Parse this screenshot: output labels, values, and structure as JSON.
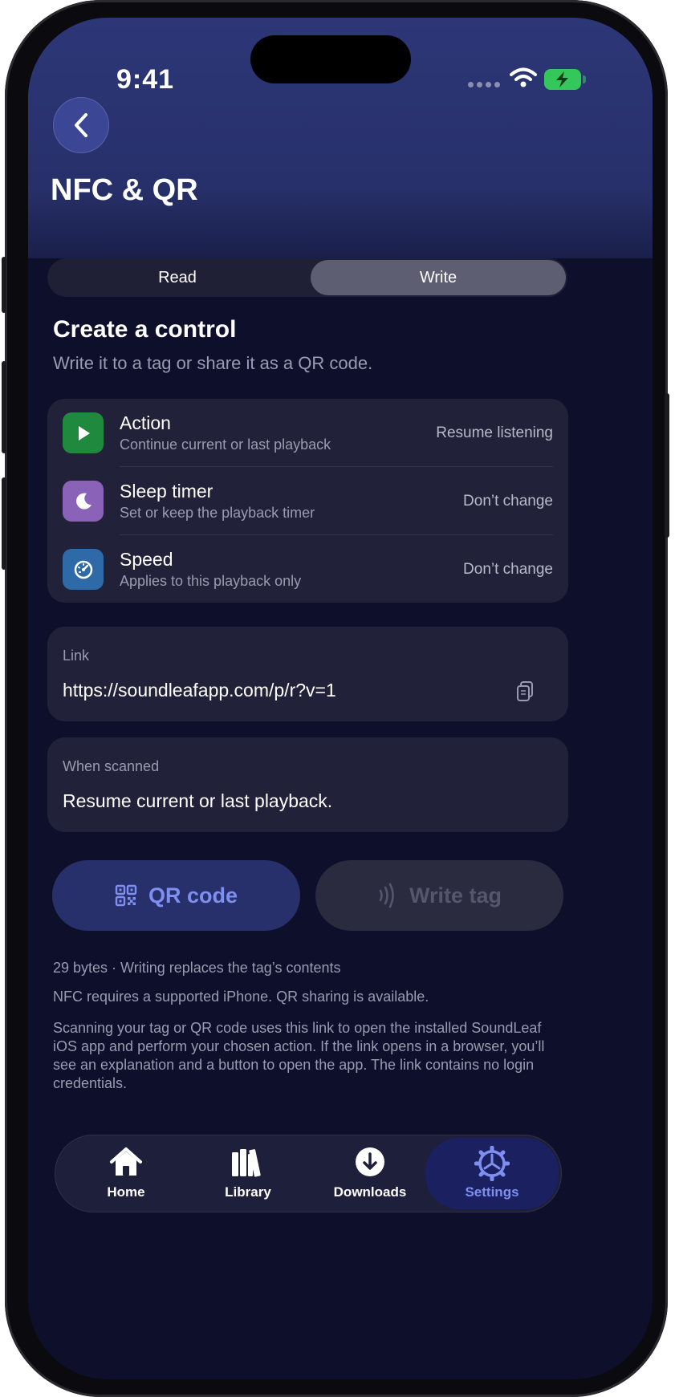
{
  "status_bar": {
    "time": "9:41"
  },
  "header": {
    "title": "NFC & QR"
  },
  "segmented": {
    "options": [
      "Read",
      "Write"
    ],
    "selected": "Write"
  },
  "section": {
    "title": "Create a control",
    "subtitle": "Write it to a tag or share it as a QR code."
  },
  "settings": [
    {
      "title": "Action",
      "subtitle": "Continue current or last playback",
      "value": "Resume listening",
      "icon": "play-icon",
      "color": "#1f8a3e"
    },
    {
      "title": "Sleep timer",
      "subtitle": "Set or keep the playback timer",
      "value": "Don’t change",
      "icon": "moon-icon",
      "color": "#8a63b8"
    },
    {
      "title": "Speed",
      "subtitle": "Applies to this playback only",
      "value": "Don’t change",
      "icon": "speedometer-icon",
      "color": "#2f6aa8"
    }
  ],
  "link": {
    "label": "Link",
    "value": "https://soundleafapp.com/p/r?v=1"
  },
  "when_scanned": {
    "label": "When scanned",
    "value": "Resume current or last playback."
  },
  "buttons": {
    "qr": "QR code",
    "write": "Write tag"
  },
  "notes": {
    "bytes": "29 bytes · Writing replaces the tag’s contents",
    "nfc": "NFC requires a supported iPhone. QR sharing is available.",
    "info": "Scanning your tag or QR code uses this link to open the installed SoundLeaf iOS app and perform your chosen action. If the link opens in a browser, you’ll see an explanation and a button to open the app. The link contains no login credentials."
  },
  "tabs": [
    {
      "label": "Home",
      "icon": "house-icon"
    },
    {
      "label": "Library",
      "icon": "books-icon"
    },
    {
      "label": "Downloads",
      "icon": "download-icon"
    },
    {
      "label": "Settings",
      "icon": "gear-icon",
      "active": true
    }
  ],
  "colors": {
    "accent": "#7e8ff0",
    "background": "#0e0f2b",
    "card": "#21223a"
  }
}
